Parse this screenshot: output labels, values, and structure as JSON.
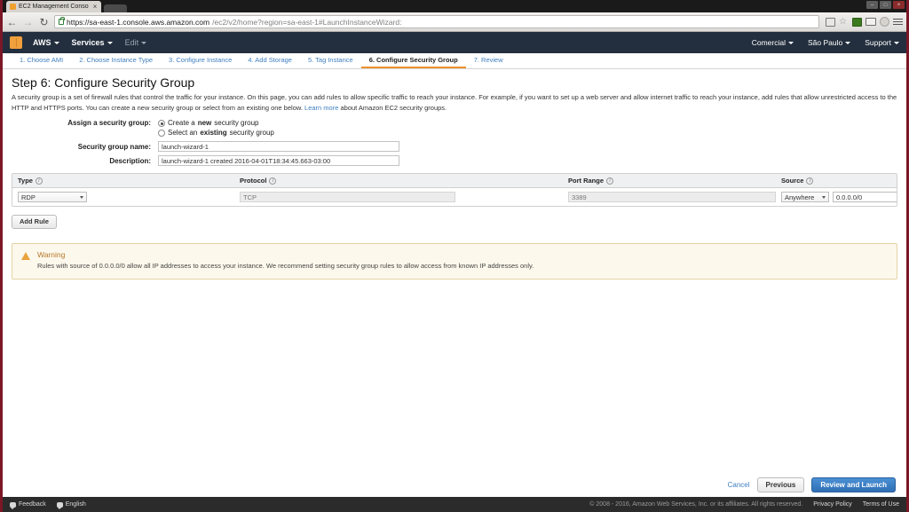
{
  "browser": {
    "tab_title": "EC2 Management Conso",
    "tab_close": "×",
    "back_icon": "←",
    "forward_icon": "→",
    "reload_icon": "↻",
    "url_secure": "https://sa-east-1.console.aws.amazon.com",
    "url_path": "/ec2/v2/home?region=sa-east-1#LaunchInstanceWizard:",
    "window_minimize": "–",
    "window_maximize": "□",
    "window_close": "×"
  },
  "topnav": {
    "aws_label": "AWS",
    "services_label": "Services",
    "edit_label": "Edit",
    "account_label": "Comercial",
    "region_label": "São Paulo",
    "support_label": "Support"
  },
  "wizard": {
    "steps": [
      {
        "label": "1. Choose AMI",
        "active": false
      },
      {
        "label": "2. Choose Instance Type",
        "active": false
      },
      {
        "label": "3. Configure Instance",
        "active": false
      },
      {
        "label": "4. Add Storage",
        "active": false
      },
      {
        "label": "5. Tag Instance",
        "active": false
      },
      {
        "label": "6. Configure Security Group",
        "active": true
      },
      {
        "label": "7. Review",
        "active": false
      }
    ]
  },
  "page": {
    "title": "Step 6: Configure Security Group",
    "description_part1": "A security group is a set of firewall rules that control the traffic for your instance. On this page, you can add rules to allow specific traffic to reach your instance. For example, if you want to set up a web server and allow internet traffic to reach your instance, add rules that allow unrestricted access to the HTTP and HTTPS ports. You can create a new security group or select from an existing one below. ",
    "learn_more": "Learn more",
    "description_part2": " about Amazon EC2 security groups."
  },
  "form": {
    "assign_label": "Assign a security group:",
    "radio_new_prefix": "Create a ",
    "radio_new_strong": "new",
    "radio_new_suffix": " security group",
    "radio_existing_prefix": "Select an ",
    "radio_existing_strong": "existing",
    "radio_existing_suffix": " security group",
    "name_label": "Security group name:",
    "name_value": "launch-wizard-1",
    "description_label": "Description:",
    "description_value": "launch-wizard-1 created 2016-04-01T18:34:45.663-03:00"
  },
  "rules": {
    "columns": [
      {
        "label": "Type",
        "info": "i"
      },
      {
        "label": "Protocol",
        "info": "i"
      },
      {
        "label": "Port Range",
        "info": "i"
      },
      {
        "label": "Source",
        "info": "i"
      }
    ],
    "rows": [
      {
        "type": "RDP",
        "protocol": "TCP",
        "port_range": "3389",
        "source_mode": "Anywhere",
        "source_cidr": "0.0.0.0/0",
        "delete_icon": "×"
      }
    ],
    "add_rule_label": "Add Rule"
  },
  "warning": {
    "title": "Warning",
    "text": "Rules with source of 0.0.0.0/0 allow all IP addresses to access your instance. We recommend setting security group rules to allow access from known IP addresses only."
  },
  "actions": {
    "cancel_label": "Cancel",
    "previous_label": "Previous",
    "primary_label": "Review and Launch"
  },
  "footer": {
    "feedback_label": "Feedback",
    "language_label": "English",
    "copyright": "© 2008 - 2016, Amazon Web Services, Inc. or its affiliates. All rights reserved.",
    "privacy_label": "Privacy Policy",
    "terms_label": "Terms of Use"
  }
}
